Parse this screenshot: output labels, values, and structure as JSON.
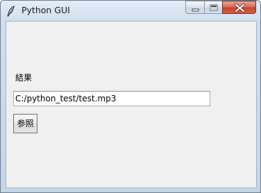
{
  "window": {
    "title": "Python GUI",
    "controls": {
      "minimize_icon": "minimize-icon",
      "maximize_icon": "maximize-icon",
      "close_icon": "close-icon"
    }
  },
  "main": {
    "result_label": "結果",
    "file_path": "C:/python_test/test.mp3",
    "browse_button_label": "参照"
  },
  "colors": {
    "client_background": "#f0f0f0",
    "close_button": "#c4432a",
    "titlebar": "#cfdff0"
  }
}
